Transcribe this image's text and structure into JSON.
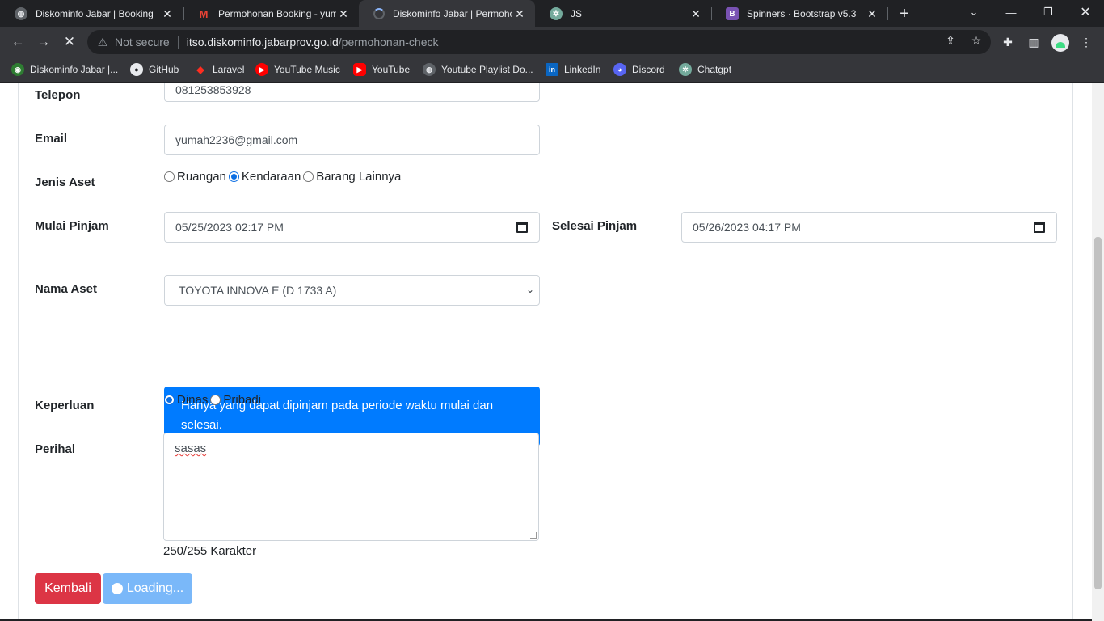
{
  "browser": {
    "tabs": [
      {
        "title": "Diskominfo Jabar | Booking",
        "icon": "globe-icon"
      },
      {
        "title": "Permohonan Booking - yuma",
        "icon": "gmail-icon"
      },
      {
        "title": "Diskominfo Jabar | Permohon",
        "icon": "loading-spinner-icon"
      },
      {
        "title": "JS",
        "icon": "chatgpt-icon"
      },
      {
        "title": "Spinners · Bootstrap v5.3",
        "icon": "bootstrap-icon"
      }
    ],
    "address": {
      "security_label": "Not secure",
      "host": "itso.diskominfo.jabarprov.go.id",
      "path": "/permohonan-check"
    },
    "bookmarks": [
      {
        "label": "Diskominfo Jabar |...",
        "icon": "diskominfo-icon"
      },
      {
        "label": "GitHub",
        "icon": "github-icon"
      },
      {
        "label": "Laravel",
        "icon": "laravel-icon"
      },
      {
        "label": "YouTube Music",
        "icon": "youtube-music-icon"
      },
      {
        "label": "YouTube",
        "icon": "youtube-icon"
      },
      {
        "label": "Youtube Playlist Do...",
        "icon": "globe-icon"
      },
      {
        "label": "LinkedIn",
        "icon": "linkedin-icon"
      },
      {
        "label": "Discord",
        "icon": "discord-icon"
      },
      {
        "label": "Chatgpt",
        "icon": "chatgpt-icon"
      }
    ]
  },
  "form": {
    "telepon": {
      "label": "Telepon",
      "value": "081253853928"
    },
    "email": {
      "label": "Email",
      "value": "yumah2236@gmail.com"
    },
    "jenis_aset": {
      "label": "Jenis Aset",
      "options": [
        "Ruangan",
        "Kendaraan",
        "Barang Lainnya"
      ],
      "selected": "Kendaraan"
    },
    "mulai_pinjam": {
      "label": "Mulai Pinjam",
      "value": "05/25/2023 02:17 PM"
    },
    "selesai_pinjam": {
      "label": "Selesai Pinjam",
      "value": "05/26/2023 04:17 PM"
    },
    "nama_aset": {
      "label": "Nama Aset",
      "value": "TOYOTA INNOVA E (D 1733 A)"
    },
    "info_alert": "Hanya yang dapat dipinjam pada periode waktu mulai dan selesai.",
    "keperluan": {
      "label": "Keperluan",
      "options": [
        "Dinas",
        "Pribadi"
      ],
      "selected": "Dinas"
    },
    "perihal": {
      "label": "Perihal",
      "value": "sasas"
    },
    "counter": "250/255 Karakter",
    "buttons": {
      "back": "Kembali",
      "loading": "Loading..."
    }
  },
  "colors": {
    "primary": "#007bff",
    "danger": "#dc3545",
    "loading_button": "#7ab8f9",
    "browser_dark": "#202124",
    "browser_toolbar": "#35363a"
  }
}
